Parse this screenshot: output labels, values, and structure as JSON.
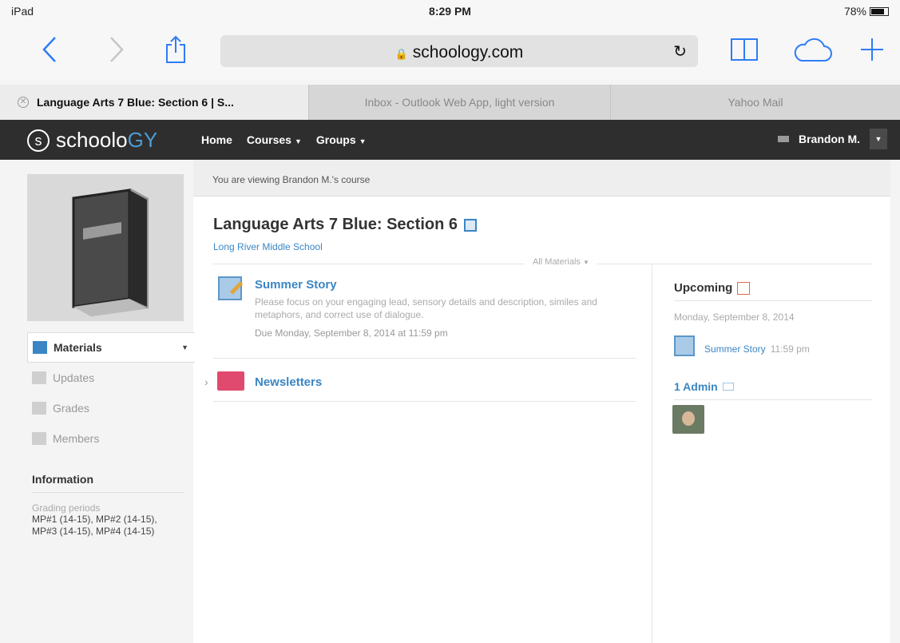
{
  "statusbar": {
    "device": "iPad",
    "time": "8:29 PM",
    "battery": "78%",
    "battery_level": 0.78
  },
  "browser": {
    "url": "schoology.com",
    "tabs": [
      {
        "label": "Language Arts 7 Blue: Section 6 | S...",
        "active": true
      },
      {
        "label": "Inbox - Outlook Web App, light version",
        "active": false
      },
      {
        "label": "Yahoo Mail",
        "active": false
      }
    ]
  },
  "header": {
    "logo_main": "schoolo",
    "logo_accent": "GY",
    "logo_s": "s",
    "nav": {
      "home": "Home",
      "courses": "Courses",
      "groups": "Groups"
    },
    "user": "Brandon M."
  },
  "sidebar": {
    "menu": {
      "materials": "Materials",
      "updates": "Updates",
      "grades": "Grades",
      "members": "Members"
    },
    "info": {
      "title": "Information",
      "label": "Grading periods",
      "value": "MP#1 (14-15), MP#2 (14-15), MP#3 (14-15), MP#4 (14-15)"
    }
  },
  "main": {
    "viewing": "You are viewing Brandon M.'s course",
    "course_title": "Language Arts 7 Blue: Section 6",
    "school": "Long River Middle School",
    "filter": "All Materials",
    "materials": [
      {
        "title": "Summer Story",
        "description": "Please focus on your engaging lead, sensory details and description, similes and metaphors, and correct use of dialogue.",
        "due": "Due Monday, September 8, 2014 at 11:59 pm"
      }
    ],
    "folder": "Newsletters"
  },
  "rightbar": {
    "upcoming_title": "Upcoming",
    "date": "Monday, September 8, 2014",
    "item": "Summer Story",
    "item_time": "11:59 pm",
    "admin_title": "1 Admin"
  }
}
